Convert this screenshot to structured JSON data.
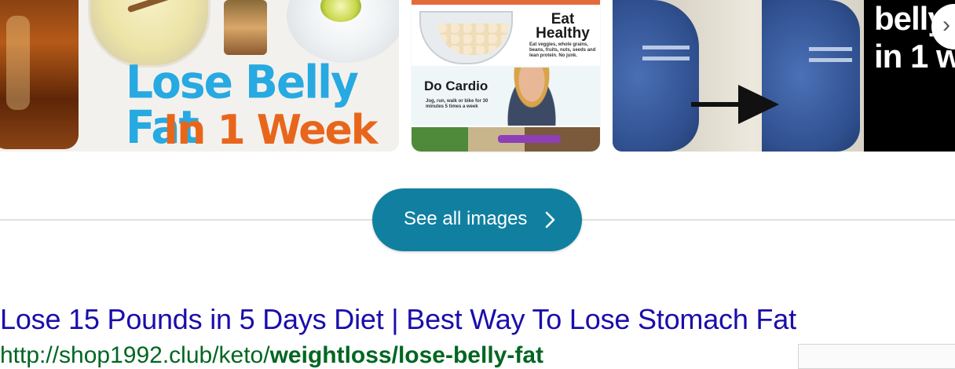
{
  "images": [
    {
      "headline": "Lose Belly Fat",
      "subline": "In 1 Week"
    },
    {
      "panels": [
        {
          "heading": "Eat Healthy",
          "caption": "Eat veggies, whole grains, beans, fruits, nuts, seeds and lean protein. No junk."
        },
        {
          "heading": "Do Cardio",
          "caption": "Jog, run, walk or bike for 30 minutes 5 times a week"
        }
      ]
    },
    {
      "overlay_text": "belly\nin 1 w"
    }
  ],
  "see_all": {
    "label": "See all images",
    "color": "#1180a0"
  },
  "result": {
    "title": "Lose 15 Pounds in 5 Days Diet | Best Way To Lose Stomach Fat",
    "url_prefix": "http://shop1992.club/keto/",
    "url_bold": "weightloss/lose-belly-fat",
    "title_color": "#1a0dab",
    "url_color": "#006621"
  }
}
